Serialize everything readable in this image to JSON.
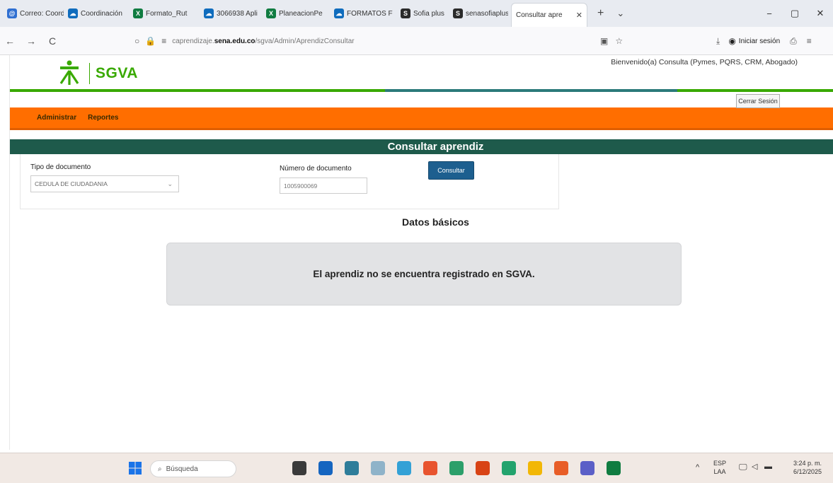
{
  "browser": {
    "tabs": [
      {
        "label": "Correo: Coord",
        "color": "#2f6fd1",
        "glyph": "@"
      },
      {
        "label": "Coordinación",
        "color": "#0f6cbd",
        "glyph": "☁"
      },
      {
        "label": "Formato_Rut",
        "color": "#107c41",
        "glyph": "X"
      },
      {
        "label": "3066938 Apli",
        "color": "#0f6cbd",
        "glyph": "☁"
      },
      {
        "label": "PlaneacionPe",
        "color": "#107c41",
        "glyph": "X"
      },
      {
        "label": "FORMATOS F",
        "color": "#0f6cbd",
        "glyph": "☁"
      },
      {
        "label": "Sofia plus",
        "color": "#2b2b2b",
        "glyph": "S"
      },
      {
        "label": "senasofiaplus",
        "color": "#2b2b2b",
        "glyph": "S"
      }
    ],
    "active_tab": {
      "label": "Consultar apre",
      "close": "✕"
    },
    "new_tab": "+",
    "tab_list": "⌄",
    "window": {
      "minimize": "−",
      "maximize": "▢",
      "close": "✕"
    },
    "nav": {
      "back": "←",
      "forward": "→",
      "reload": "C"
    },
    "url_prefix": "caprendizaje.",
    "url_host": "sena.edu.co",
    "url_path": "/sgva/Admin/AprendizConsultar",
    "sign_in": "Iniciar sesión"
  },
  "header": {
    "logo_text": "SGVA",
    "logo_mark": "SENA",
    "welcome": "Bienvenido(a) Consulta (Pymes, PQRS, CRM, Abogado)",
    "logout": "Cerrar Sesión"
  },
  "menu": {
    "items": [
      "Administrar",
      "Reportes"
    ]
  },
  "consult": {
    "title": "Consultar aprendiz",
    "doc_type_label": "Tipo de documento",
    "doc_type_value": "CEDULA DE CIUDADANIA",
    "doc_number_label": "Número de documento",
    "doc_number_value": "1005900069",
    "button": "Consultar"
  },
  "results": {
    "subtitle": "Datos básicos",
    "message": "El aprendiz no se encuentra registrado en SGVA."
  },
  "taskbar": {
    "search": "Búsqueda",
    "apps": [
      {
        "name": "file-explorer",
        "color": "#3a3a3a"
      },
      {
        "name": "outlook",
        "color": "#1565c0"
      },
      {
        "name": "photos",
        "color": "#2e7d9a"
      },
      {
        "name": "tool",
        "color": "#8fb3c9"
      },
      {
        "name": "edge",
        "color": "#33a1d6"
      },
      {
        "name": "chrome",
        "color": "#e8542f"
      },
      {
        "name": "browser",
        "color": "#2c9f6a"
      },
      {
        "name": "app",
        "color": "#d84315"
      },
      {
        "name": "store",
        "color": "#23a36d"
      },
      {
        "name": "folder",
        "color": "#f2b705"
      },
      {
        "name": "firefox",
        "color": "#e85d27"
      },
      {
        "name": "teams",
        "color": "#5b5fc7"
      },
      {
        "name": "excel",
        "color": "#107c41"
      }
    ],
    "lang_top": "ESP",
    "lang_bottom": "LAA",
    "time": "3:24 p. m.",
    "date": "6/12/2025"
  }
}
